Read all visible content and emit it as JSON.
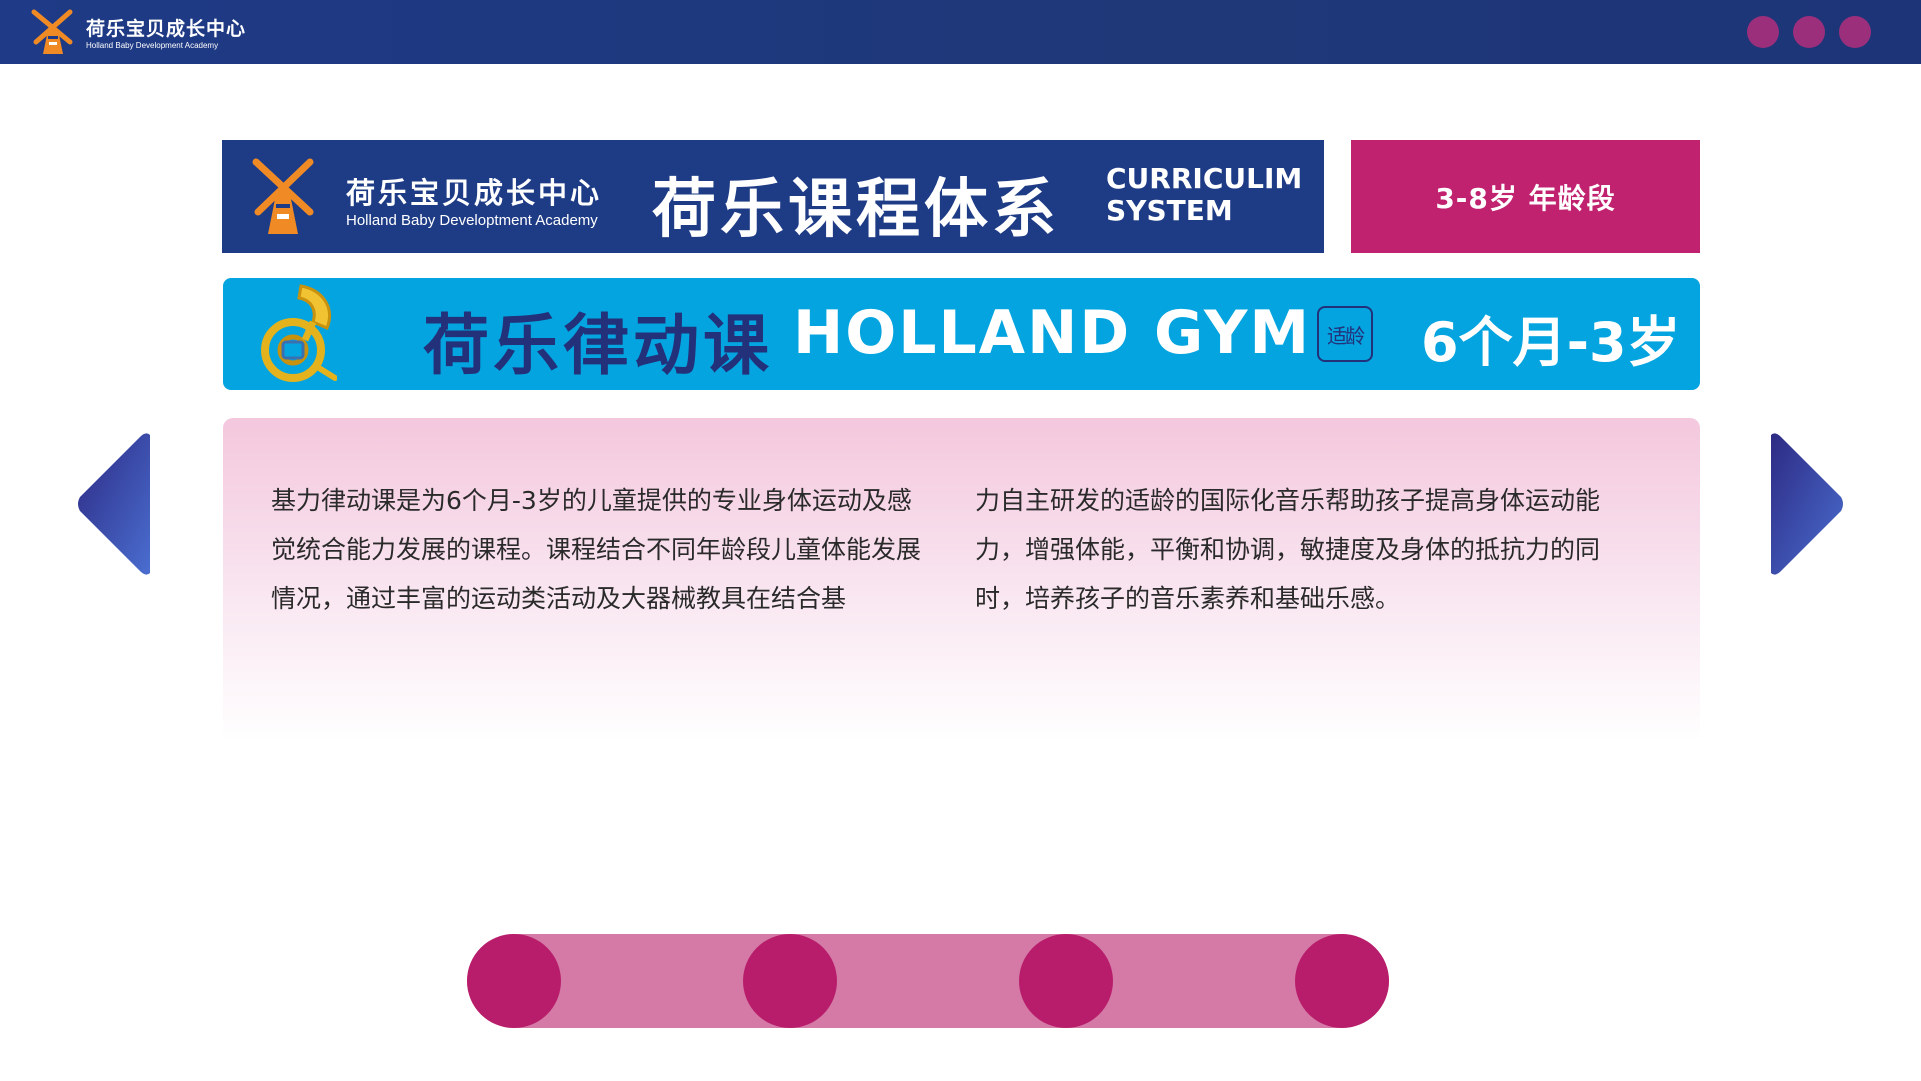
{
  "topbar": {
    "logo_title": "荷乐宝贝成长中心",
    "logo_subtitle": "Holland Baby Development Academy",
    "window_dots": [
      "dot-1",
      "dot-2",
      "dot-3"
    ]
  },
  "banner": {
    "brand_cn": "荷乐宝贝成长中心",
    "brand_en": "Holland Baby Developtment Academy",
    "title": "荷乐课程体系",
    "title_en_line1": "CURRICULIM",
    "title_en_line2": "SYSTEM",
    "age_range": "3-8岁  年龄段"
  },
  "course": {
    "name_cn": "荷乐律动课",
    "name_en": "HOLLAND GYM",
    "seal_text": "适龄",
    "age": "6个月-3岁",
    "icon": "french-horn-icon"
  },
  "description": {
    "left": "基力律动课是为6个月-3岁的儿童提供的专业身体运动及感觉统合能力发展的课程。课程结合不同年龄段儿童体能发展情况，通过丰富的运动类活动及大器械教具在结合基",
    "right": "力自主研发的适龄的国际化音乐帮助孩子提高身体运动能力，增强体能，平衡和协调，敏捷度及身体的抵抗力的同时，培养孩子的音乐素养和基础乐感。"
  },
  "navigation": {
    "prev_icon": "triangle-left-icon",
    "next_icon": "triangle-right-icon"
  },
  "pager": {
    "page_count": 4
  },
  "colors": {
    "navy": "#1e3b86",
    "magenta": "#c0226f",
    "sky": "#03a4df",
    "pager_track": "#d579a6",
    "pager_dot": "#b81d6c"
  }
}
